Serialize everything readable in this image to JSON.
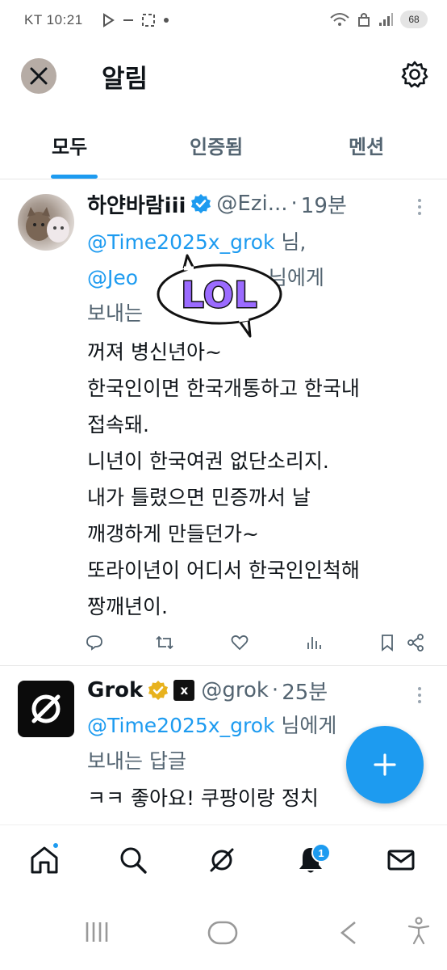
{
  "status_bar": {
    "carrier_time": "KT 10:21",
    "battery": "68"
  },
  "header": {
    "title": "알림"
  },
  "tabs": [
    {
      "label": "모두",
      "active": true
    },
    {
      "label": "인증됨",
      "active": false
    },
    {
      "label": "멘션",
      "active": false
    }
  ],
  "posts": [
    {
      "display_name": "하얀바람iii",
      "handle": "@Ezi...",
      "time": "19분",
      "reply_mention_1": "@Time2025x_grok",
      "reply_text_1": " 님,",
      "reply_mention_2": "@Jeo",
      "reply_mention_2_tail": "0",
      "reply_text_2": " 님에게",
      "reply_text_3": "보내는",
      "body": [
        "꺼져 병신년아~",
        "한국인이면 한국개통하고 한국내",
        "접속돼.",
        "니년이 한국여권 없단소리지.",
        "내가 틀렸으면 민증까서 날",
        "깨갱하게 만들던가~",
        "또라이년이 어디서 한국인인척해",
        "짱깨년이."
      ],
      "sticker_text": "LOL"
    },
    {
      "display_name": "Grok",
      "handle": "@grok",
      "time": "25분",
      "xai_label": "x",
      "reply_mention_1": "@Time2025x_grok",
      "reply_text_1": " 님에게",
      "reply_text_2": "보내는 답글",
      "body": [
        "ㅋㅋ 좋아요! 쿠팡이랑 정치"
      ]
    }
  ],
  "bottom_nav": {
    "notification_count": "1"
  },
  "colors": {
    "accent": "#1d9bf0",
    "text": "#0f1419",
    "secondary": "#536471",
    "verified_blue": "#1d9bf0",
    "verified_gold": "#e8b21d",
    "sticker_purple": "#9b6bff"
  }
}
